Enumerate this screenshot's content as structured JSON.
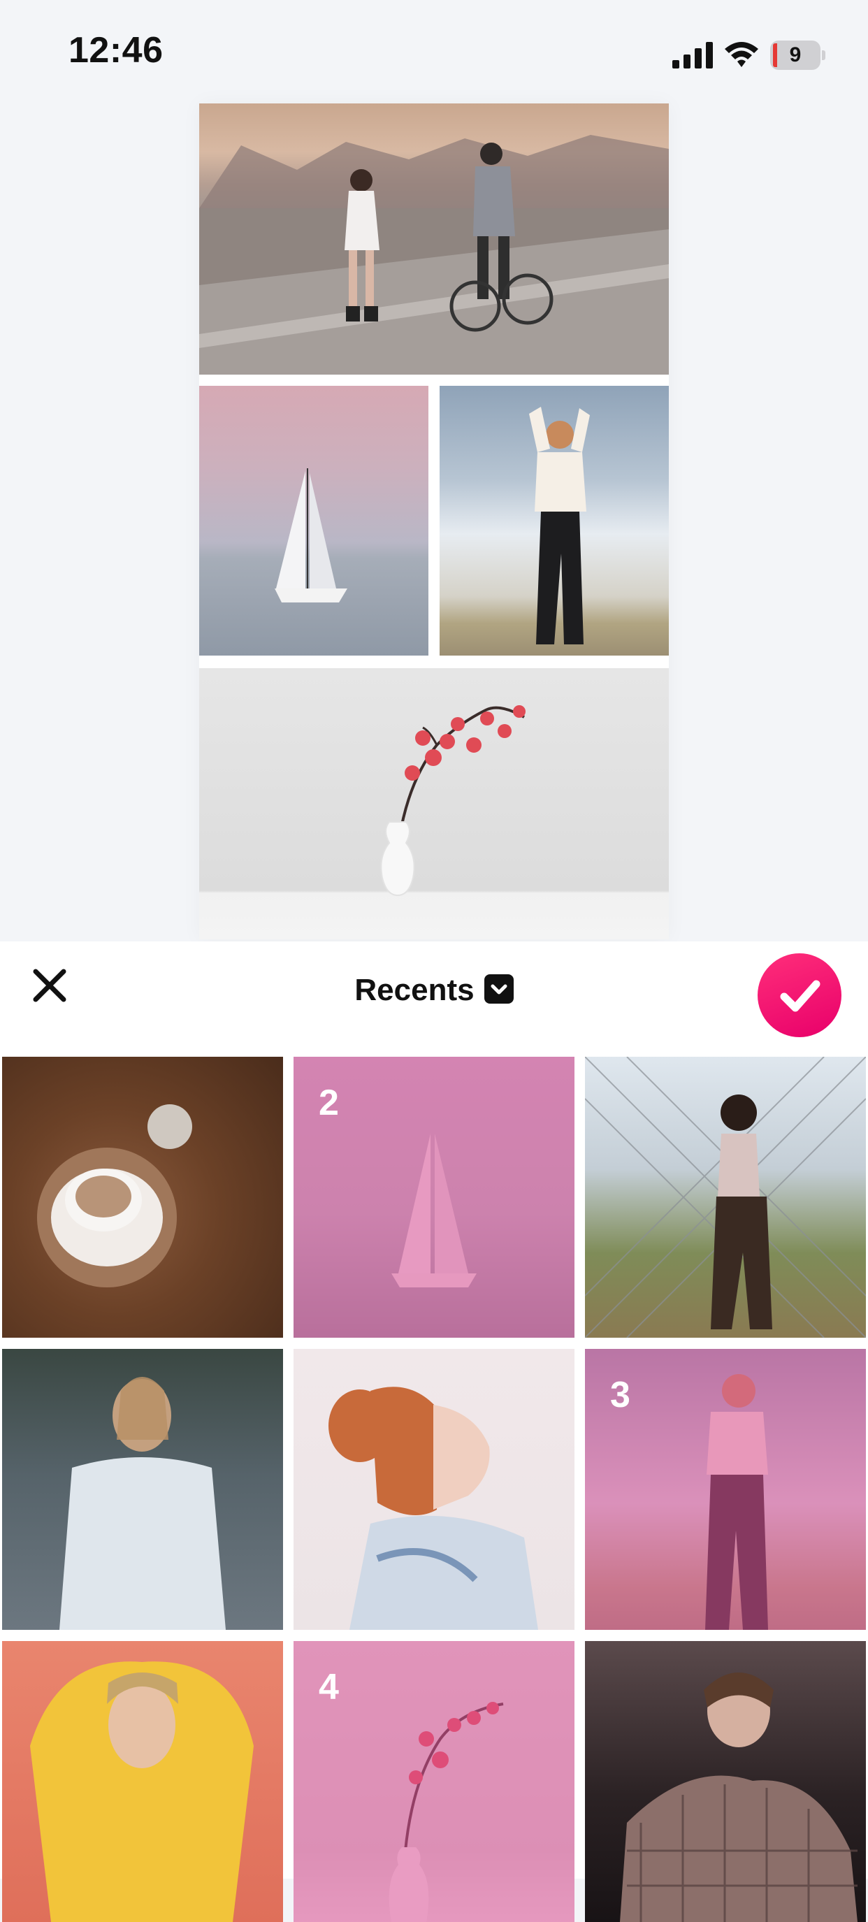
{
  "status_bar": {
    "time": "12:46",
    "battery_level": "9"
  },
  "collage": {
    "photos": [
      "beach-couple-bike",
      "sailboat",
      "woman-posing",
      "flower-vase"
    ]
  },
  "sheet": {
    "title": "Recents",
    "close_icon": "close-icon",
    "confirm_icon": "checkmark-icon",
    "dropdown_icon": "chevron-down-icon"
  },
  "grid": {
    "items": [
      {
        "subject": "coffee-cup",
        "selected_number": ""
      },
      {
        "subject": "sailboat",
        "selected_number": "2"
      },
      {
        "subject": "woman-at-fence",
        "selected_number": ""
      },
      {
        "subject": "woman-white-tee",
        "selected_number": ""
      },
      {
        "subject": "redhead-profile",
        "selected_number": ""
      },
      {
        "subject": "woman-posing",
        "selected_number": "3"
      },
      {
        "subject": "woman-yellow-sweater",
        "selected_number": ""
      },
      {
        "subject": "flower-vase",
        "selected_number": "4"
      },
      {
        "subject": "man-checkered-jacket",
        "selected_number": ""
      }
    ]
  },
  "colors": {
    "accent": "#f0186f",
    "selection_tint": "#dc5096"
  }
}
